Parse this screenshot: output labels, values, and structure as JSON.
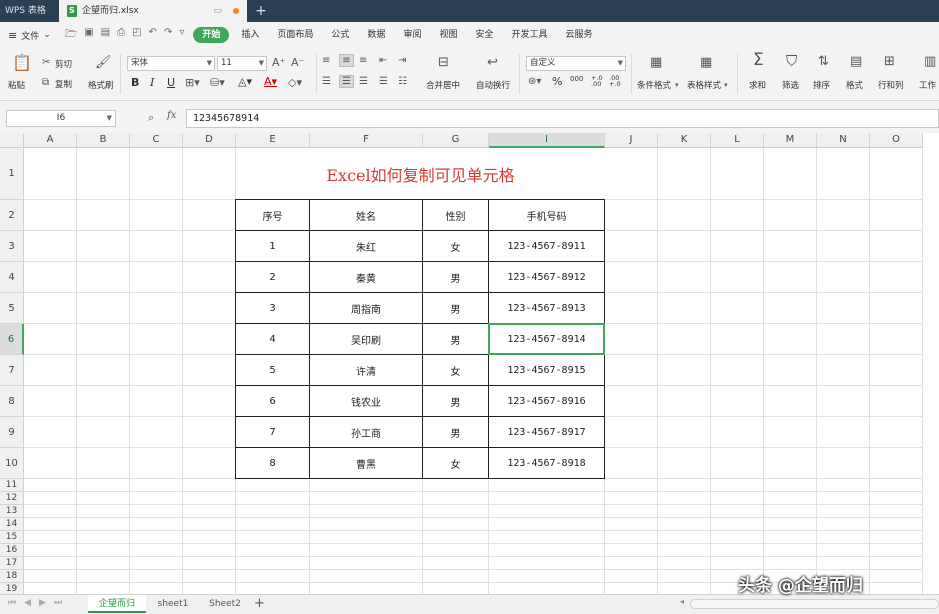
{
  "titlebar": {
    "app_name": "WPS 表格",
    "file_name": "企望而归.xlsx",
    "new_tab": "+"
  },
  "menubar": {
    "file_label": "文件",
    "items": [
      "开始",
      "插入",
      "页面布局",
      "公式",
      "数据",
      "审阅",
      "视图",
      "安全",
      "开发工具",
      "云服务"
    ],
    "active_item": "开始"
  },
  "ribbon": {
    "paste": "粘贴",
    "cut": "剪切",
    "copy": "复制",
    "format_painter": "格式刷",
    "font_name": "宋体",
    "font_size": "11",
    "bold": "B",
    "italic": "I",
    "underline": "U",
    "merge_center": "合并居中",
    "wrap_text": "自动换行",
    "number_format": "自定义",
    "percent": "%",
    "thousands": "000",
    "inc_decimal": "+.0 .00",
    "dec_decimal": ".00 +.0",
    "conditional_format": "条件格式",
    "table_style": "表格样式",
    "sum": "求和",
    "filter": "筛选",
    "sort": "排序",
    "format": "格式",
    "rows_cols": "行和列",
    "worksheet": "工作"
  },
  "formula_bar": {
    "name_box": "I6",
    "fx": "fx",
    "formula": "12345678914"
  },
  "sheet": {
    "columns": [
      "A",
      "B",
      "C",
      "D",
      "E",
      "F",
      "G",
      "I",
      "J",
      "K",
      "L",
      "M",
      "N",
      "O"
    ],
    "selected_column": "I",
    "rows": [
      "1",
      "2",
      "3",
      "4",
      "5",
      "6",
      "7",
      "8",
      "9",
      "10",
      "11",
      "12",
      "13",
      "14",
      "15",
      "16",
      "17",
      "18",
      "19"
    ],
    "selected_row": "6",
    "title": "Excel如何复制可见单元格",
    "table": {
      "headers": [
        "序号",
        "姓名",
        "性别",
        "手机号码"
      ],
      "rows": [
        [
          "1",
          "朱红",
          "女",
          "123-4567-8911"
        ],
        [
          "2",
          "秦黄",
          "男",
          "123-4567-8912"
        ],
        [
          "3",
          "周指南",
          "男",
          "123-4567-8913"
        ],
        [
          "4",
          "吴印刷",
          "男",
          "123-4567-8914"
        ],
        [
          "5",
          "许清",
          "女",
          "123-4567-8915"
        ],
        [
          "6",
          "钱农业",
          "男",
          "123-4567-8916"
        ],
        [
          "7",
          "孙工商",
          "男",
          "123-4567-8917"
        ],
        [
          "8",
          "曹黑",
          "女",
          "123-4567-8918"
        ]
      ]
    }
  },
  "sheet_tabs": {
    "tabs": [
      "企望而归",
      "sheet1",
      "Sheet2"
    ],
    "active": "企望而归",
    "add": "+"
  },
  "watermark": "头条 @企望而归",
  "colors": {
    "accent": "#3fa85b",
    "title_red": "#d83b35",
    "titlebar": "#2b3f55"
  }
}
